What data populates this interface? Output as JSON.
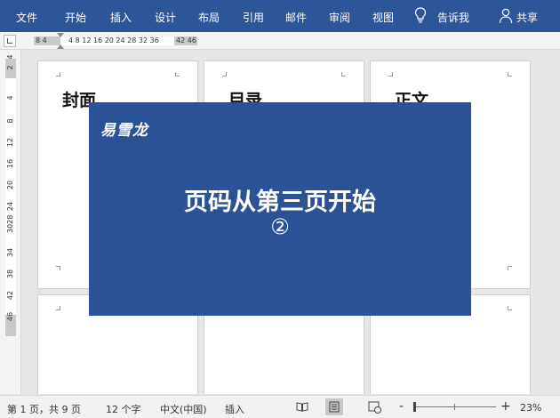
{
  "ribbon": {
    "tabs": [
      "文件",
      "开始",
      "插入",
      "设计",
      "布局",
      "引用",
      "邮件",
      "审阅",
      "视图"
    ],
    "tell_me": "告诉我",
    "share": "共享",
    "bg_color": "#2b579a"
  },
  "ruler": {
    "horizontal_left": "8  4",
    "horizontal_mid": "4  8 12 16 20 24 28 32 36",
    "horizontal_right": "42 46",
    "vertical": [
      "2",
      "4",
      "4",
      "8",
      "12",
      "16",
      "20",
      "24",
      "3028",
      "34",
      "38",
      "42",
      "46"
    ]
  },
  "pages": [
    {
      "title": "封面"
    },
    {
      "title": "目录"
    },
    {
      "title": "正文"
    },
    {
      "title": ""
    },
    {
      "title": ""
    },
    {
      "title": ""
    }
  ],
  "overlay": {
    "brand": "易雪龙",
    "headline": "页码从第三页开始",
    "step": "②",
    "bg_color": "#295396"
  },
  "status": {
    "page_info": "第 1 页，共 9 页",
    "word_count": "12 个字",
    "language": "中文(中国)",
    "mode": "插入",
    "zoom_minus": "-",
    "zoom_plus": "+",
    "zoom_percent": "23%"
  },
  "icons": {
    "lightbulb": "lightbulb-icon",
    "share": "person-icon",
    "read_mode": "read-mode-icon",
    "print_layout": "print-layout-icon",
    "web_layout": "web-layout-icon"
  }
}
